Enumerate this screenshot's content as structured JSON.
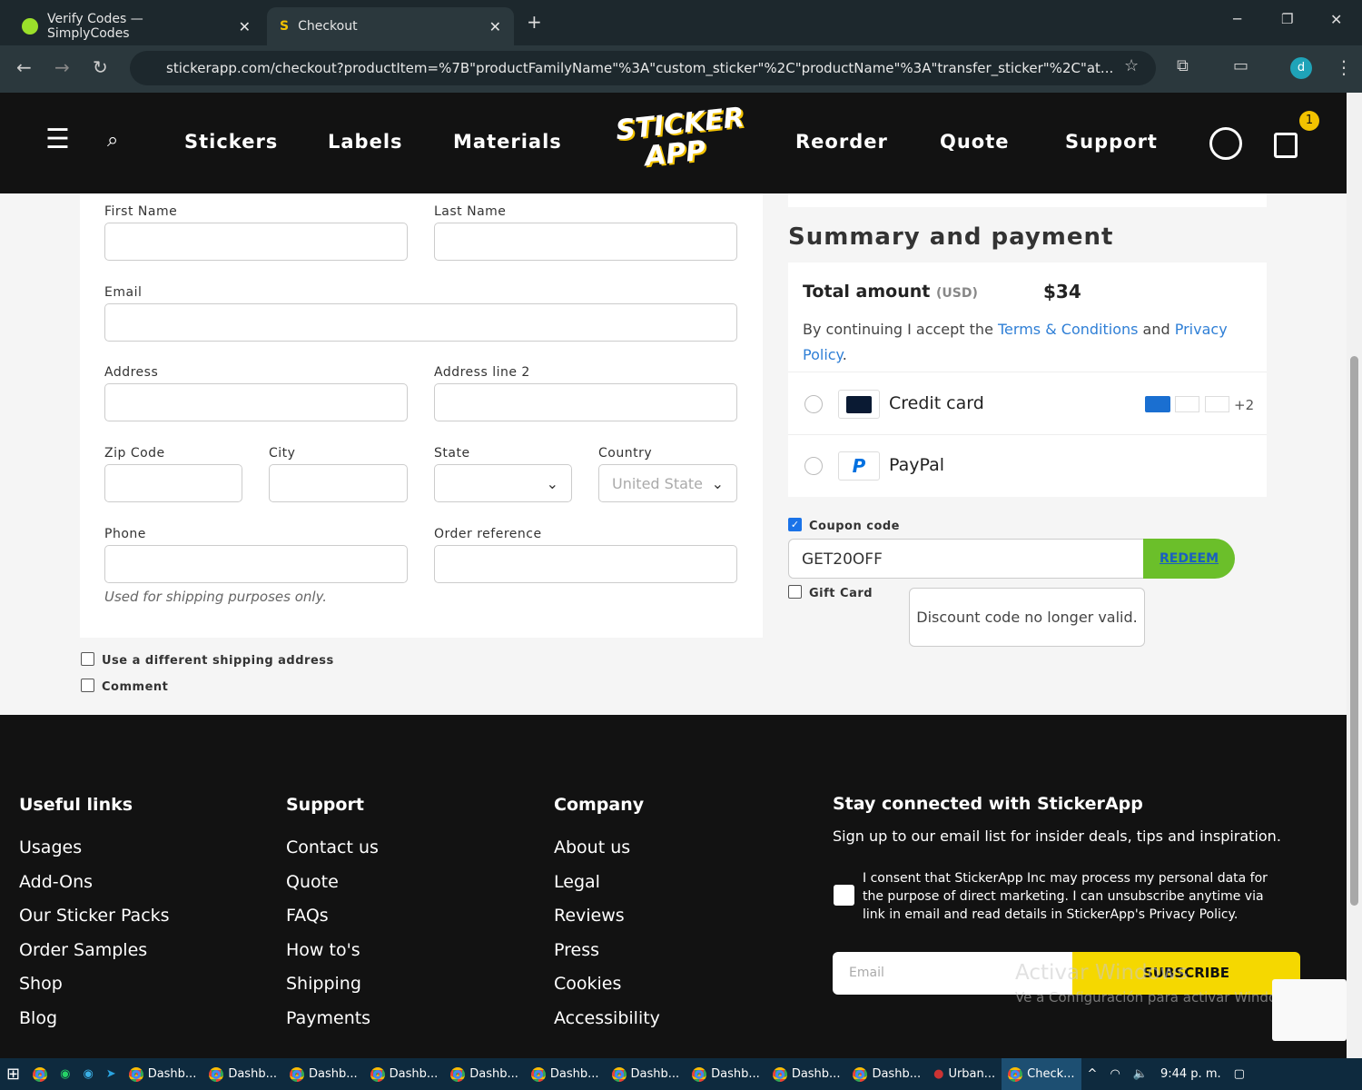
{
  "browser": {
    "tabs": [
      {
        "title": "Verify Codes — SimplyCodes"
      },
      {
        "title": "Checkout"
      }
    ],
    "new_tab": "+",
    "url": "stickerapp.com/checkout?productItem=%7B\"productFamilyName\"%3A\"custom_sticker\"%2C\"productName\"%3A\"transfer_sticker\"%2C\"at...",
    "profile": "d",
    "window": {
      "minimize": "─",
      "restore": "❐",
      "close": "✕"
    }
  },
  "header": {
    "nav": [
      "Stickers",
      "Labels",
      "Materials",
      "Reorder",
      "Quote",
      "Support"
    ],
    "logo": "STICKER APP",
    "cart_count": "1"
  },
  "form": {
    "first_name": "First Name",
    "last_name": "Last Name",
    "email": "Email",
    "address": "Address",
    "address2": "Address line 2",
    "zip": "Zip Code",
    "city": "City",
    "state": "State",
    "country": "Country",
    "country_value": "United States",
    "phone": "Phone",
    "order_ref": "Order reference",
    "phone_hint": "Used for shipping purposes only.",
    "diff_shipping": "Use a different shipping address",
    "comment": "Comment"
  },
  "summary": {
    "title": "Summary and payment",
    "total_label": "Total amount",
    "currency": "(USD)",
    "total": "$34",
    "terms_pre": "By continuing I accept the ",
    "terms_link": "Terms & Conditions",
    "terms_and": " and ",
    "privacy_link": "Privacy Policy",
    "terms_end": ".",
    "methods": [
      {
        "label": "Credit card",
        "extra": "+2"
      },
      {
        "label": "PayPal"
      }
    ],
    "coupon_label": "Coupon code",
    "coupon_value": "GET20OFF",
    "redeem": "REDEEM",
    "gift_card": "Gift Card",
    "error": "Discount code no longer valid.",
    "accent": "#6bbf2a"
  },
  "footer": {
    "cols": [
      {
        "title": "Useful links",
        "items": [
          "Usages",
          "Add-Ons",
          "Our Sticker Packs",
          "Order Samples",
          "Shop",
          "Blog"
        ]
      },
      {
        "title": "Support",
        "items": [
          "Contact us",
          "Quote",
          "FAQs",
          "How to's",
          "Shipping",
          "Payments"
        ]
      },
      {
        "title": "Company",
        "items": [
          "About us",
          "Legal",
          "Reviews",
          "Press",
          "Cookies",
          "Accessibility"
        ]
      }
    ],
    "news_title": "Stay connected with StickerApp",
    "news_sub": "Sign up to our email list for insider deals, tips and inspiration.",
    "consent": "I consent that StickerApp Inc may process my personal data for the purpose of direct marketing. I can unsubscribe anytime via link in email and read details in StickerApp's Privacy Policy.",
    "email_placeholder": "Email",
    "subscribe": "SUBSCRIBE",
    "watermark1": "Activar Windows",
    "watermark2": "Ve a Configuración para activar Windows."
  },
  "taskbar": {
    "items": [
      "Dashb...",
      "Dashb...",
      "Dashb...",
      "Dashb...",
      "Dashb...",
      "Dashb...",
      "Dashb...",
      "Dashb...",
      "Dashb...",
      "Dashb...",
      "Urban...",
      "Check..."
    ],
    "time": "9:44 p. m."
  }
}
